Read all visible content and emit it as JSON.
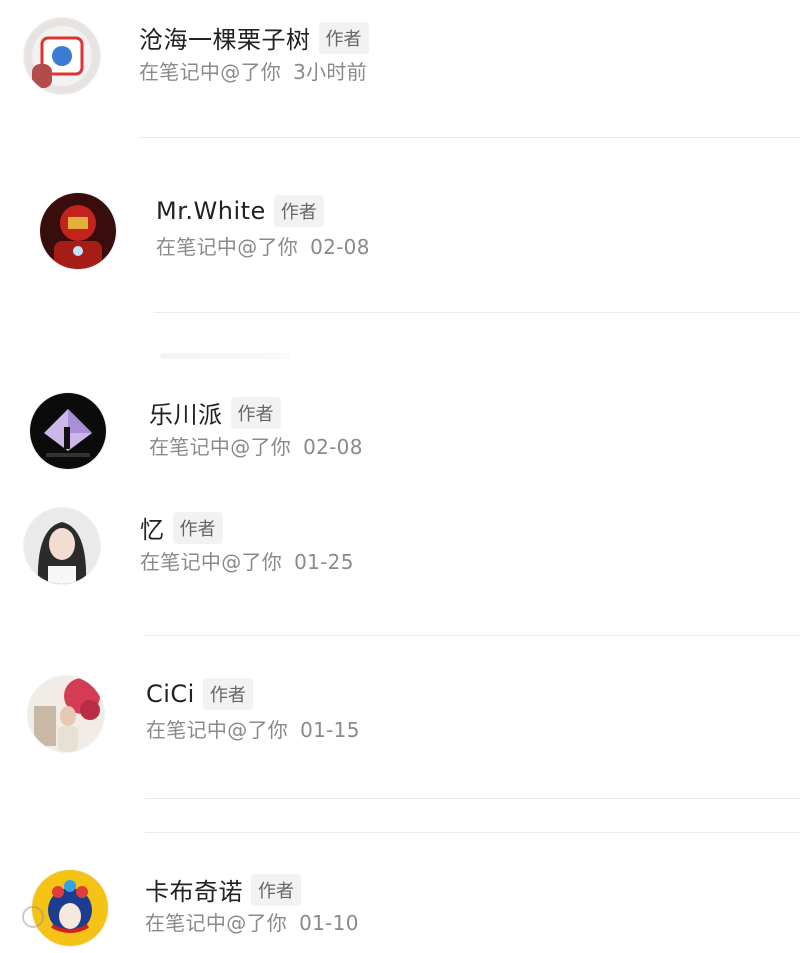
{
  "items": [
    {
      "name": "沧海一棵栗子树",
      "badge": "作者",
      "action": "在笔记中@了你",
      "time": "3小时前",
      "avatar": "avatar-figure-red-white"
    },
    {
      "name": "Mr.White",
      "badge": "作者",
      "action": "在笔记中@了你",
      "time": "02-08",
      "avatar": "avatar-iron-man"
    },
    {
      "name": "乐川派",
      "badge": "作者",
      "action": "在笔记中@了你",
      "time": "02-08",
      "avatar": "avatar-silhouette-triangle"
    },
    {
      "name": "忆",
      "badge": "作者",
      "action": "在笔记中@了你",
      "time": "01-25",
      "avatar": "avatar-woman-portrait"
    },
    {
      "name": "CiCi",
      "badge": "作者",
      "action": "在笔记中@了你",
      "time": "01-15",
      "avatar": "avatar-woman-flowers"
    },
    {
      "name": "卡布奇诺",
      "badge": "作者",
      "action": "在笔记中@了你",
      "time": "01-10",
      "avatar": "avatar-opera-headdress"
    }
  ],
  "colors": {
    "name": "#222222",
    "meta": "#8a8a8a",
    "badge_bg": "#f2f2f2",
    "divider": "#e9e9e9"
  }
}
